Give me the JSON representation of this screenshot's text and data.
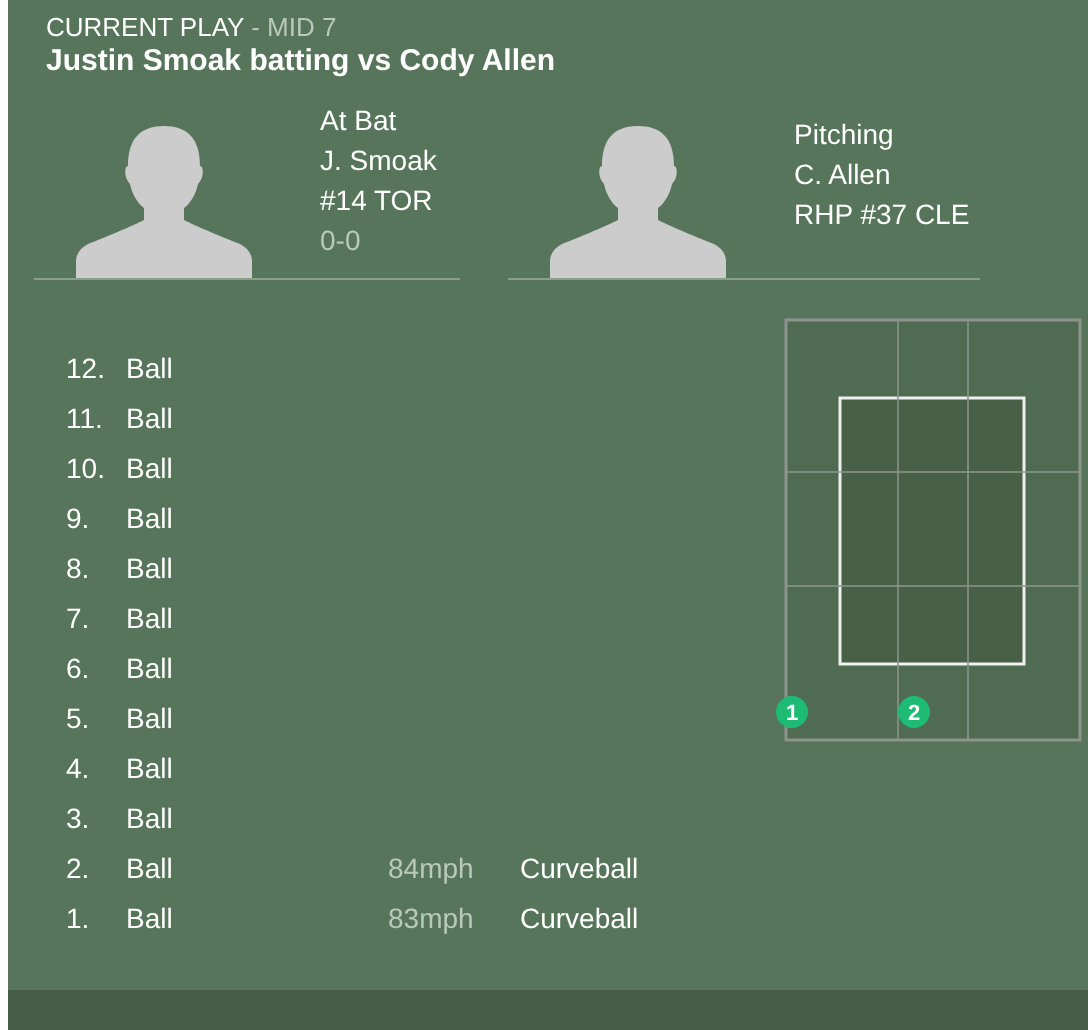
{
  "header": {
    "label": "CURRENT PLAY",
    "inning": "- MID 7",
    "title": "Justin Smoak batting vs Cody Allen"
  },
  "players": [
    {
      "lines": [
        "At Bat",
        "J. Smoak",
        "#14 TOR"
      ],
      "count": "0-0"
    },
    {
      "lines": [
        "Pitching",
        "C. Allen",
        "RHP #37 CLE"
      ]
    }
  ],
  "pitches": [
    {
      "number": "12.",
      "result": "Ball"
    },
    {
      "number": "11.",
      "result": "Ball"
    },
    {
      "number": "10.",
      "result": "Ball"
    },
    {
      "number": "9.",
      "result": "Ball"
    },
    {
      "number": "8.",
      "result": "Ball"
    },
    {
      "number": "7.",
      "result": "Ball"
    },
    {
      "number": "6.",
      "result": "Ball"
    },
    {
      "number": "5.",
      "result": "Ball"
    },
    {
      "number": "4.",
      "result": "Ball"
    },
    {
      "number": "3.",
      "result": "Ball"
    },
    {
      "number": "2.",
      "result": "Ball",
      "speed": "84mph",
      "type": "Curveball"
    },
    {
      "number": "1.",
      "result": "Ball",
      "speed": "83mph",
      "type": "Curveball"
    }
  ],
  "zone_markers": [
    "1",
    "2"
  ]
}
